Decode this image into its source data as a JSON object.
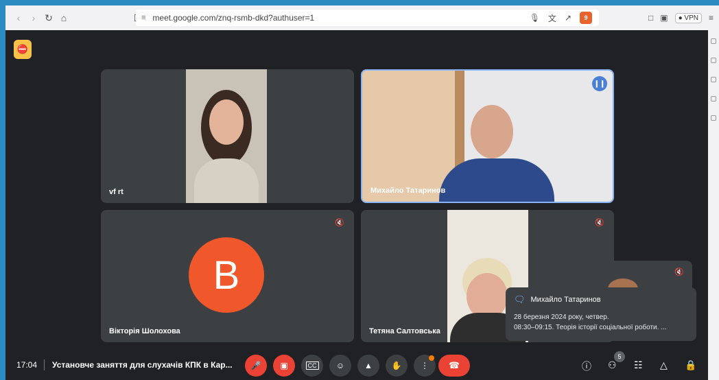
{
  "browser": {
    "url": "meet.google.com/znq-rsmb-dkd?authuser=1",
    "vpn_label": "VPN",
    "brave_badge": "9"
  },
  "tiles": [
    {
      "name": "vf rt"
    },
    {
      "name": "Михайло Татаринов"
    },
    {
      "name": "Вікторія Шолохова",
      "avatar_letter": "В"
    },
    {
      "name": "Тетяна Салтовська"
    }
  ],
  "notification": {
    "sender": "Михайло Татаринов",
    "line1": "28 березня 2024 року, четвер.",
    "line2": "08:30–09:15. Теорія історії соціальної роботи. ..."
  },
  "bottom_bar": {
    "time": "17:04",
    "meeting_title": "Установче заняття для слухачів КПК в Кар...",
    "participants_count": "5"
  },
  "colors": {
    "background": "#202124",
    "tile": "#3c4043",
    "red": "#ea4335",
    "avatar_orange": "#f0572a",
    "accent_blue": "#4a7fd6"
  }
}
